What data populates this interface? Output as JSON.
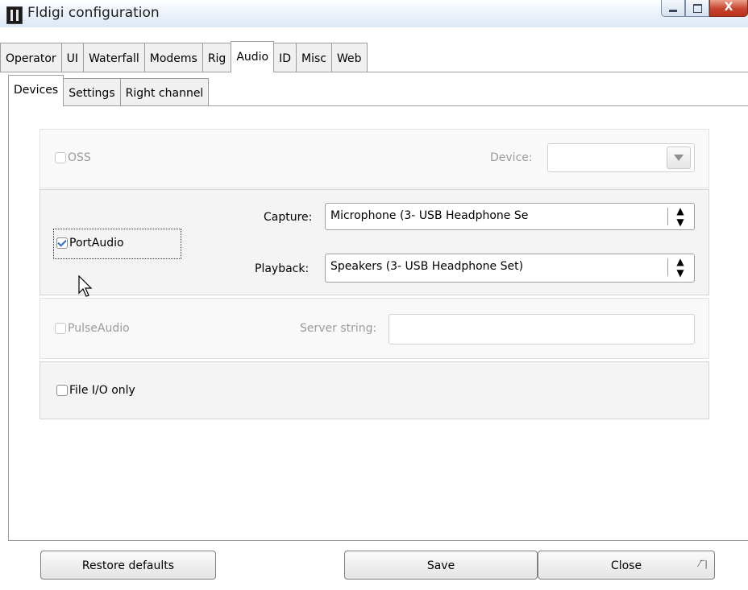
{
  "window": {
    "title": "Fldigi configuration",
    "close_glyph": "X"
  },
  "tabs_main": [
    {
      "label": "Operator",
      "active": false
    },
    {
      "label": "UI",
      "active": false
    },
    {
      "label": "Waterfall",
      "active": false
    },
    {
      "label": "Modems",
      "active": false
    },
    {
      "label": "Rig",
      "active": false
    },
    {
      "label": "Audio",
      "active": true
    },
    {
      "label": "ID",
      "active": false
    },
    {
      "label": "Misc",
      "active": false
    },
    {
      "label": "Web",
      "active": false
    }
  ],
  "tabs_sub": [
    {
      "label": "Devices",
      "active": true
    },
    {
      "label": "Settings",
      "active": false
    },
    {
      "label": "Right channel",
      "active": false
    }
  ],
  "devices": {
    "oss": {
      "label": "OSS",
      "checked": false,
      "enabled": false,
      "device_label": "Device:",
      "device_value": ""
    },
    "portaudio": {
      "label": "PortAudio",
      "checked": true,
      "enabled": true,
      "capture_label": "Capture:",
      "capture_value": "Microphone (3- USB Headphone Se",
      "playback_label": "Playback:",
      "playback_value": "Speakers (3- USB Headphone Set)"
    },
    "pulseaudio": {
      "label": "PulseAudio",
      "checked": false,
      "enabled": false,
      "server_label": "Server string:",
      "server_value": ""
    },
    "fileio": {
      "label": "File I/O only",
      "checked": false,
      "enabled": true
    }
  },
  "buttons": {
    "restore": "Restore defaults",
    "save": "Save",
    "close": "Close"
  },
  "icons": {
    "app": "fldigi-app-icon",
    "spinner": "up-down-arrows-icon",
    "dropdown": "chevron-down-icon",
    "cursor": "mouse-pointer-icon",
    "grip": "resize-grip-icon"
  },
  "colors": {
    "tab_border": "#9d9d9d",
    "group_bg": "#f4f4f4",
    "disabled_text": "#9b9b9b",
    "close_button": "#c7432b"
  }
}
